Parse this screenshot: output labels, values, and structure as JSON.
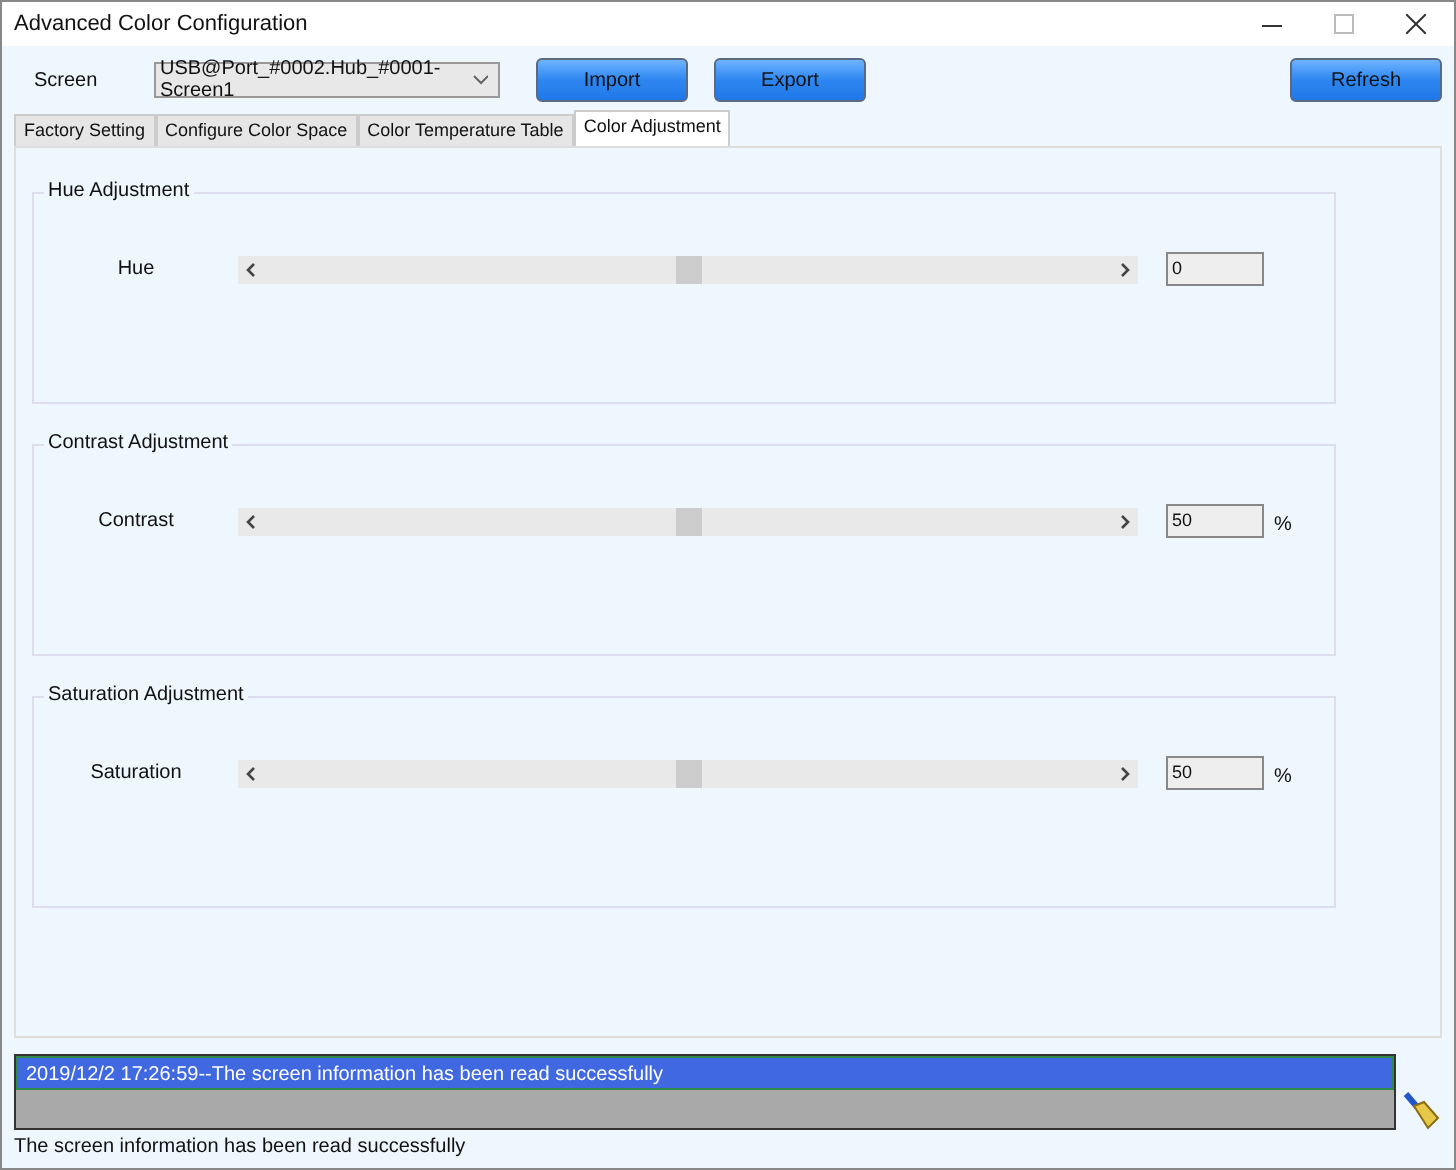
{
  "window": {
    "title": "Advanced Color Configuration"
  },
  "toolbar": {
    "screen_label": "Screen",
    "screen_value": "USB@Port_#0002.Hub_#0001-Screen1",
    "buttons": [
      "Import",
      "Export"
    ],
    "refresh": "Refresh"
  },
  "tabs": [
    {
      "label": "Factory Setting",
      "selected": false
    },
    {
      "label": "Configure Color Space",
      "selected": false
    },
    {
      "label": "Color Temperature Table",
      "selected": false
    },
    {
      "label": "Color Adjustment",
      "selected": true
    }
  ],
  "groups": [
    {
      "title": "Hue Adjustment",
      "label": "Hue",
      "level": 0.5,
      "value": "0"
    },
    {
      "title": "Contrast Adjustment",
      "label": "Contrast",
      "level": 0.5,
      "value": "50",
      "unit": "%"
    },
    {
      "title": "Saturation Adjustment",
      "label": "Saturation",
      "level": 0.5,
      "value": "50",
      "unit": "%"
    }
  ],
  "log": [
    {
      "text": "2019/12/2 17:26:59--The screen information has been read successfully",
      "selected": true
    }
  ],
  "status_bar": "The screen information has been read successfully"
}
